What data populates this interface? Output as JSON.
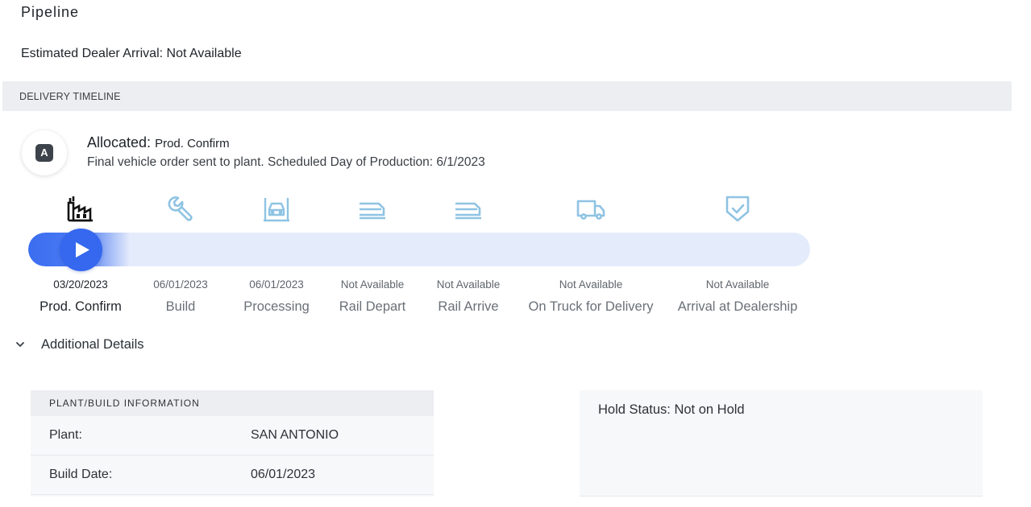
{
  "page": {
    "title": "Pipeline",
    "eta": "Estimated Dealer Arrival: Not Available"
  },
  "timeline": {
    "header": "DELIVERY TIMELINE",
    "status_badge": "A",
    "status_title": "Allocated:",
    "status_sub": "Prod. Confirm",
    "status_description": "Final vehicle order sent to plant. Scheduled Day of Production: 6/1/2023",
    "progress_fraction": 0.13,
    "stages": [
      {
        "icon": "factory-icon",
        "date": "03/20/2023",
        "label": "Prod. Confirm",
        "active": true
      },
      {
        "icon": "wrench-icon",
        "date": "06/01/2023",
        "label": "Build",
        "active": false
      },
      {
        "icon": "car-processing-icon",
        "date": "06/01/2023",
        "label": "Processing",
        "active": false
      },
      {
        "icon": "train-depart-icon",
        "date": "Not Available",
        "label": "Rail Depart",
        "active": false
      },
      {
        "icon": "train-arrive-icon",
        "date": "Not Available",
        "label": "Rail Arrive",
        "active": false
      },
      {
        "icon": "truck-icon",
        "date": "Not Available",
        "label": "On Truck for Delivery",
        "active": false
      },
      {
        "icon": "shield-check-icon",
        "date": "Not Available",
        "label": "Arrival at Dealership",
        "active": false
      }
    ]
  },
  "details": {
    "toggle_label": "Additional Details",
    "plant_card": {
      "header": "PLANT/BUILD INFORMATION",
      "rows": [
        {
          "key": "Plant:",
          "value": "SAN ANTONIO"
        },
        {
          "key": "Build Date:",
          "value": "06/01/2023"
        }
      ]
    },
    "hold_status": "Hold Status: Not on Hold"
  },
  "colors": {
    "accent": "#3567ef",
    "track": "#e4ebfb",
    "icon_inactive": "#8fc3e3",
    "icon_active": "#111111"
  }
}
